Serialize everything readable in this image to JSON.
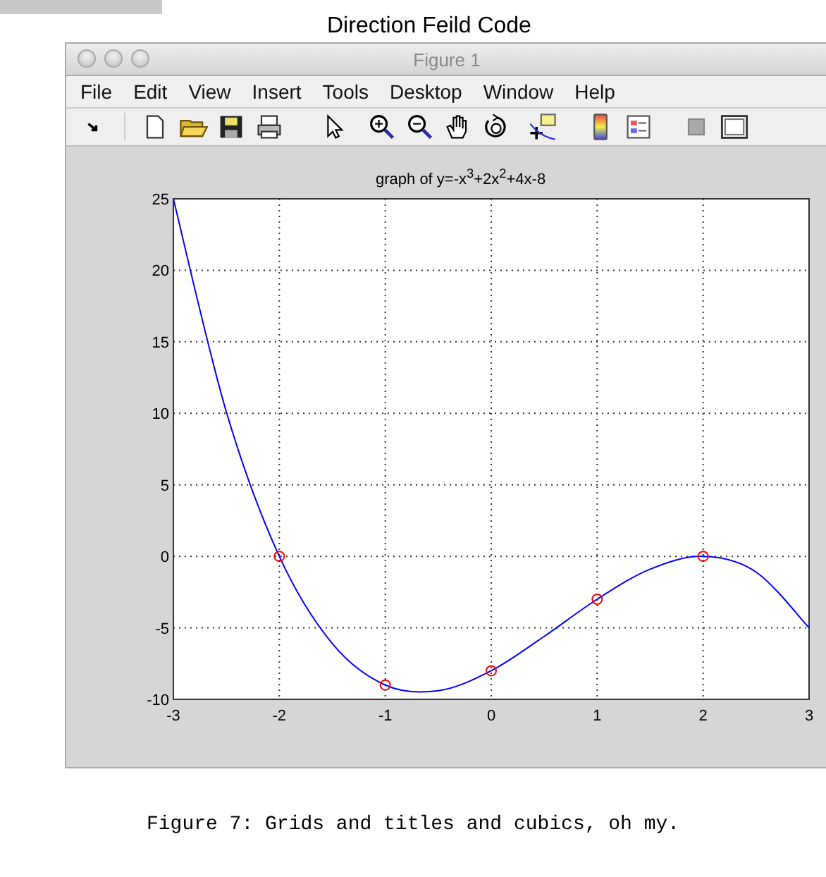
{
  "page_title": "Direction Feild Code",
  "window": {
    "title": "Figure 1"
  },
  "menu": [
    "File",
    "Edit",
    "View",
    "Insert",
    "Tools",
    "Desktop",
    "Window",
    "Help"
  ],
  "figure": {
    "chart_data": {
      "type": "line",
      "title": "graph of y=-x$^{3}$+2x$^{2}$+4x-8",
      "x": [
        -3,
        -2.5,
        -2,
        -1.5,
        -1,
        -0.5,
        0,
        0.5,
        1,
        1.5,
        2,
        2.5,
        3
      ],
      "series": [
        {
          "color": "#0000ff",
          "values": [
            25,
            10.1,
            0,
            -6.1,
            -9,
            -9.4,
            -8,
            -5.6,
            -3,
            -0.9,
            0,
            -1.1,
            -5
          ]
        },
        {
          "type": "scatter",
          "color": "#ff0000",
          "values": [
            null,
            null,
            0,
            null,
            -9,
            null,
            -8,
            null,
            -3,
            null,
            0,
            null,
            null
          ]
        }
      ],
      "grid": true,
      "xlim": [
        -3,
        3
      ],
      "ylim": [
        -10,
        25
      ],
      "xticks": [
        -3,
        -2,
        -1,
        0,
        1,
        2,
        3
      ],
      "yticks": [
        {
          "value": -10,
          "label": "-10"
        },
        {
          "value": -5,
          "label": "-5"
        },
        {
          "value": 0,
          "label": "0"
        },
        {
          "value": 5,
          "label": "5"
        },
        {
          "value": 10,
          "label": "10"
        },
        {
          "value": 15,
          "label": "15"
        },
        {
          "value": 20,
          "label": "20"
        },
        {
          "value": 25,
          "label": "25"
        }
      ]
    }
  },
  "caption": "Figure 7: Grids and titles and cubics, oh my."
}
